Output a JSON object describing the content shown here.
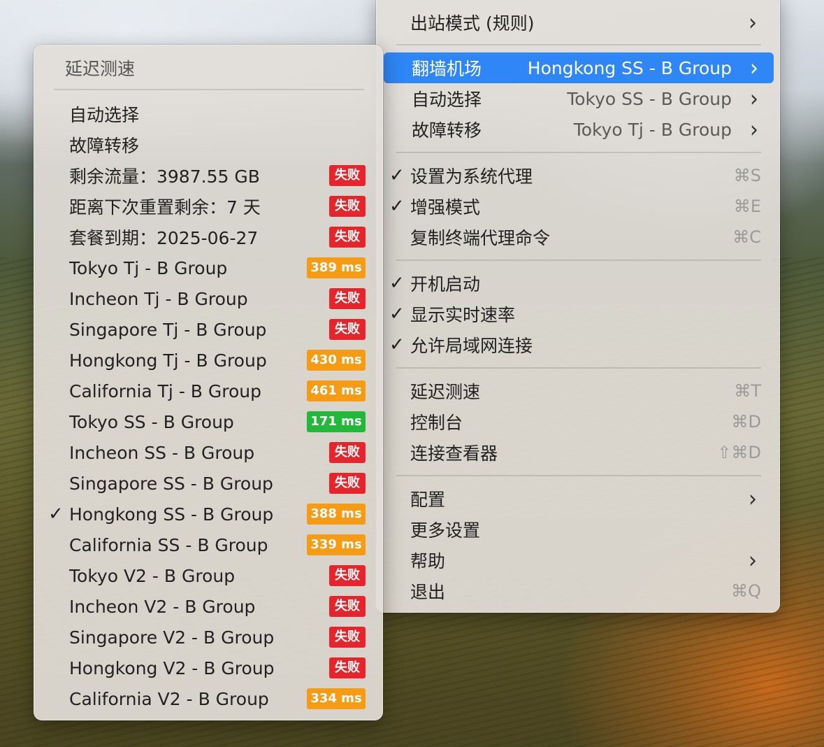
{
  "main_menu": {
    "outbound_mode": "出站模式 (规则)",
    "proxy_group": {
      "label": "翻墙机场",
      "value": "Hongkong SS - B Group"
    },
    "auto_select": {
      "label": "自动选择",
      "value": "Tokyo SS - B Group"
    },
    "failover": {
      "label": "故障转移",
      "value": "Tokyo Tj - B Group"
    },
    "system_proxy": {
      "label": "设置为系统代理",
      "shortcut": "⌘S"
    },
    "enhanced_mode": {
      "label": "增强模式",
      "shortcut": "⌘E"
    },
    "copy_terminal": {
      "label": "复制终端代理命令",
      "shortcut": "⌘C"
    },
    "launch_at_login": "开机启动",
    "show_speed": "显示实时速率",
    "allow_lan": "允许局域网连接",
    "latency_test": {
      "label": "延迟测速",
      "shortcut": "⌘T"
    },
    "dashboard": {
      "label": "控制台",
      "shortcut": "⌘D"
    },
    "connections": {
      "label": "连接查看器",
      "shortcut": "⇧⌘D"
    },
    "config": "配置",
    "more_settings": "更多设置",
    "help": "帮助",
    "quit": {
      "label": "退出",
      "shortcut": "⌘Q"
    }
  },
  "speed_menu": {
    "title": "延迟测速",
    "items": [
      {
        "label": "自动选择",
        "badge": "",
        "color": ""
      },
      {
        "label": "故障转移",
        "badge": "",
        "color": ""
      },
      {
        "label": "剩余流量：3987.55 GB",
        "badge": "失败",
        "color": "red"
      },
      {
        "label": "距离下次重置剩余：7 天",
        "badge": "失败",
        "color": "red"
      },
      {
        "label": "套餐到期：2025-06-27",
        "badge": "失败",
        "color": "red"
      },
      {
        "label": "Tokyo Tj - B Group",
        "badge": "389 ms",
        "color": "orange"
      },
      {
        "label": "Incheon Tj - B Group",
        "badge": "失败",
        "color": "red"
      },
      {
        "label": "Singapore Tj - B Group",
        "badge": "失败",
        "color": "red"
      },
      {
        "label": "Hongkong Tj - B Group",
        "badge": "430 ms",
        "color": "orange"
      },
      {
        "label": "California Tj - B Group",
        "badge": "461 ms",
        "color": "orange"
      },
      {
        "label": "Tokyo SS - B Group",
        "badge": "171 ms",
        "color": "green"
      },
      {
        "label": "Incheon SS - B Group",
        "badge": "失败",
        "color": "red"
      },
      {
        "label": "Singapore SS - B Group",
        "badge": "失败",
        "color": "red"
      },
      {
        "label": "Hongkong SS - B Group",
        "badge": "388 ms",
        "color": "orange",
        "checked": true
      },
      {
        "label": "California SS - B Group",
        "badge": "339 ms",
        "color": "orange"
      },
      {
        "label": "Tokyo V2 - B Group",
        "badge": "失败",
        "color": "red"
      },
      {
        "label": "Incheon V2 - B Group",
        "badge": "失败",
        "color": "red"
      },
      {
        "label": "Singapore V2 - B Group",
        "badge": "失败",
        "color": "red"
      },
      {
        "label": "Hongkong V2 - B Group",
        "badge": "失败",
        "color": "red"
      },
      {
        "label": "California V2 - B Group",
        "badge": "334 ms",
        "color": "orange"
      }
    ]
  },
  "colors": {
    "highlight": "#2f86f6",
    "fail": "#e5242b",
    "slow": "#f59b14",
    "fast": "#22b83a"
  }
}
